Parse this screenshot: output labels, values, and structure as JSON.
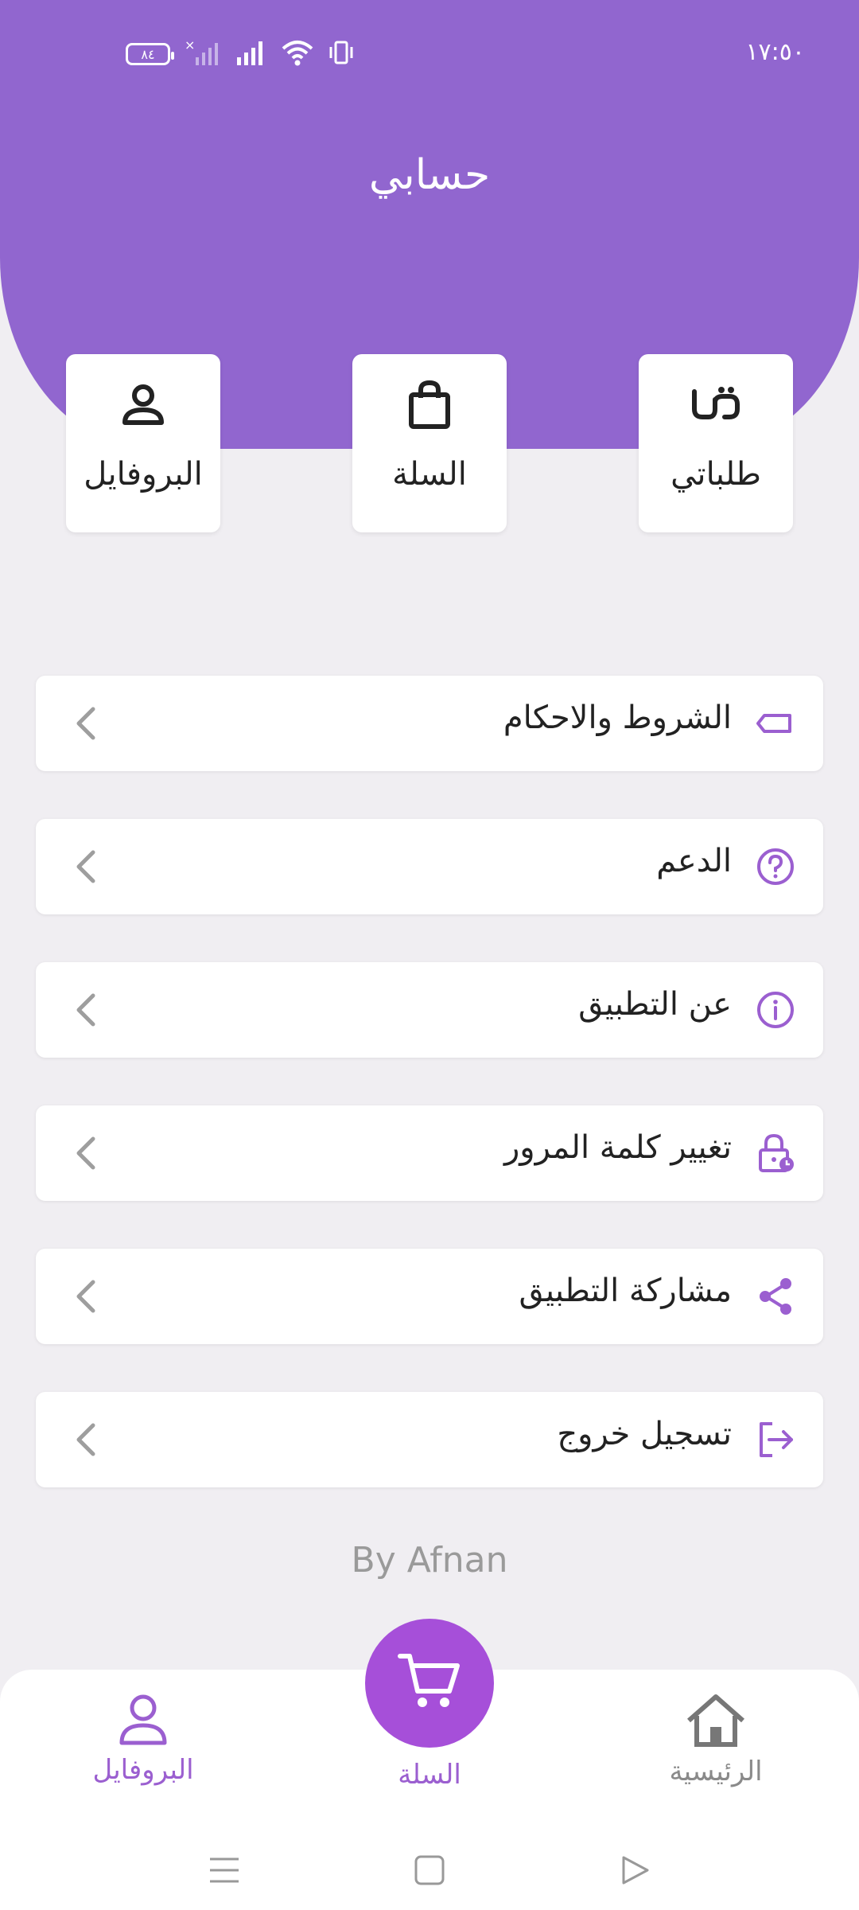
{
  "status_bar": {
    "time": "١٧:٥٠",
    "battery": "٨٤"
  },
  "header": {
    "title": "حسابي"
  },
  "quick_actions": [
    {
      "label": "طلباتي",
      "icon": "orders-icon"
    },
    {
      "label": "السلة",
      "icon": "shopping-bag-icon"
    },
    {
      "label": "البروفايل",
      "icon": "profile-icon"
    }
  ],
  "menu": [
    {
      "label": "الشروط والاحكام",
      "icon": "tag-icon"
    },
    {
      "label": "الدعم",
      "icon": "help-circle-icon"
    },
    {
      "label": "عن التطبيق",
      "icon": "info-icon"
    },
    {
      "label": "تغيير كلمة المرور",
      "icon": "lock-clock-icon"
    },
    {
      "label": "مشاركة التطبيق",
      "icon": "share-icon"
    },
    {
      "label": "تسجيل خروج",
      "icon": "logout-icon"
    }
  ],
  "credit": "By Afnan",
  "bottom_nav": {
    "home": "الرئيسية",
    "cart": "السلة",
    "profile": "البروفايل"
  },
  "colors": {
    "primary": "#9166cf",
    "fab": "#a64fd9",
    "icon_accent": "#9b5fd0",
    "inactive": "#8a8a8a",
    "background": "#f0eef2"
  }
}
